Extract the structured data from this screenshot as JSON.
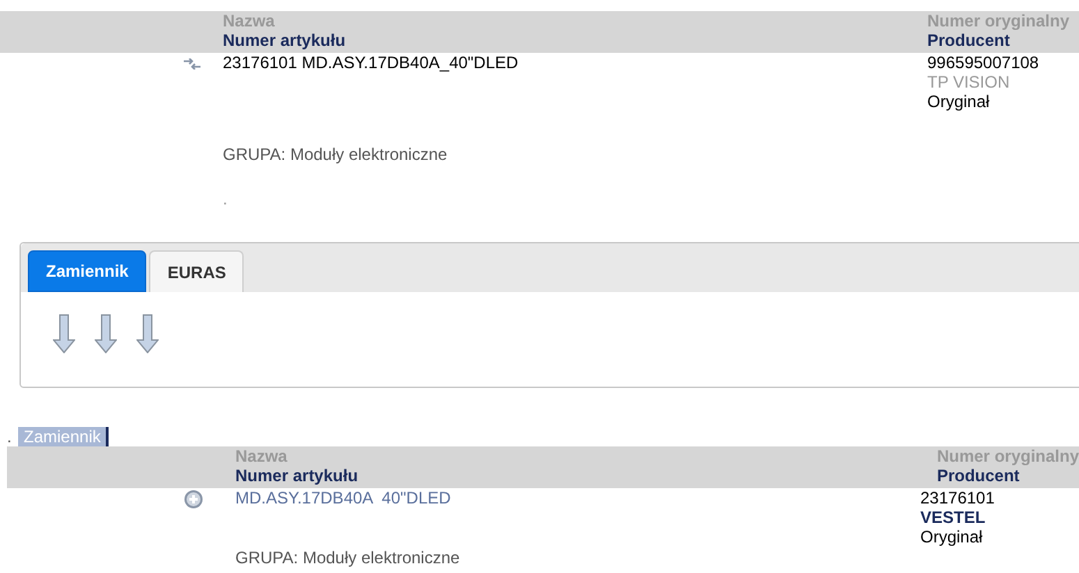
{
  "sections": [
    {
      "header": {
        "name_label": "Nazwa",
        "number_label": "Numer artykułu",
        "orig_label": "Numer oryginalny",
        "producer_label": "Producent"
      },
      "item": {
        "kind": "source",
        "name": "23176101 MD.ASY.17DB40A_40\"DLED",
        "orig_number": "996595007108",
        "producer": "TP VISION",
        "origin": "Oryginał",
        "group": "GRUPA: Moduły elektroniczne",
        "note": "."
      }
    },
    {
      "tabs": [
        {
          "label": "Zamiennik",
          "selected": true
        },
        {
          "label": "EURAS",
          "selected": false
        }
      ]
    },
    {
      "marker": ".",
      "caption": "Zamiennik",
      "header": {
        "name_label": "Nazwa",
        "number_label": "Numer artykułu",
        "orig_label": "Numer oryginalny",
        "producer_label": "Producent"
      },
      "item": {
        "kind": "replacement",
        "name": "MD.ASY.17DB40A  40\"DLED",
        "orig_number": "23176101",
        "producer": "VESTEL",
        "origin": "Oryginał",
        "group": "GRUPA: Moduły elektroniczne"
      }
    }
  ]
}
